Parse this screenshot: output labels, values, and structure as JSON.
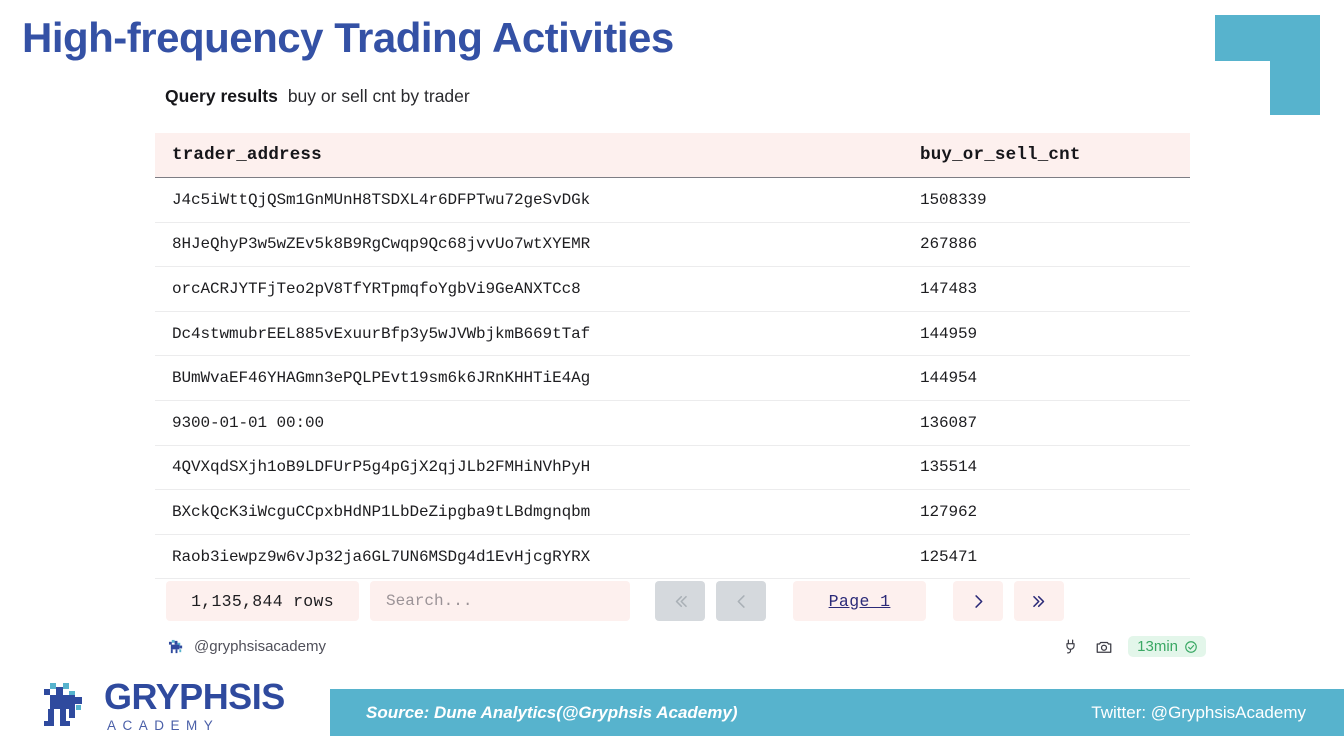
{
  "slide": {
    "title": "High-frequency Trading Activities",
    "accent_blue": "#3451a5",
    "accent_teal": "#57b3cd",
    "panel_pink": "#fdf0ee"
  },
  "query": {
    "label": "Query results",
    "name": "buy or sell cnt by trader"
  },
  "table": {
    "columns": [
      "trader_address",
      "buy_or_sell_cnt"
    ],
    "rows": [
      {
        "trader_address": "J4c5iWttQjQSm1GnMUnH8TSDXL4r6DFPTwu72geSvDGk",
        "buy_or_sell_cnt": "1508339"
      },
      {
        "trader_address": "8HJeQhyP3w5wZEv5k8B9RgCwqp9Qc68jvvUo7wtXYEMR",
        "buy_or_sell_cnt": "267886"
      },
      {
        "trader_address": "orcACRJYTFjTeo2pV8TfYRTpmqfoYgbVi9GeANXTCc8",
        "buy_or_sell_cnt": "147483"
      },
      {
        "trader_address": "Dc4stwmubrEEL885vExuurBfp3y5wJVWbjkmB669tTaf",
        "buy_or_sell_cnt": "144959"
      },
      {
        "trader_address": "BUmWvaEF46YHAGmn3ePQLPEvt19sm6k6JRnKHHTiE4Ag",
        "buy_or_sell_cnt": "144954"
      },
      {
        "trader_address": "9300-01-01 00:00",
        "buy_or_sell_cnt": "136087"
      },
      {
        "trader_address": "4QVXqdSXjh1oB9LDFUrP5g4pGjX2qjJLb2FMHiNVhPyH",
        "buy_or_sell_cnt": "135514"
      },
      {
        "trader_address": "BXckQcK3iWcguCCpxbHdNP1LbDeZipgba9tLBdmgnqbm",
        "buy_or_sell_cnt": "127962"
      },
      {
        "trader_address": "Raob3iewpz9w6vJp32ja6GL7UN6MSDg4d1EvHjcgRYRX",
        "buy_or_sell_cnt": "125471"
      }
    ]
  },
  "footer": {
    "rows_count": "1,135,844 rows",
    "search_placeholder": "Search...",
    "search_value": "",
    "first_page_label": "«",
    "prev_page_label": "‹",
    "page_label": "Page 1",
    "next_page_label": "›",
    "last_page_label": "»"
  },
  "meta": {
    "handle": "@gryphsisacademy",
    "duration": "13min"
  },
  "brand": {
    "logo_main": "GRYPHSIS",
    "logo_sub": "ACADEMY",
    "source": "Source: Dune Analytics(@Gryphsis Academy)",
    "twitter": "Twitter: @GryphsisAcademy"
  }
}
